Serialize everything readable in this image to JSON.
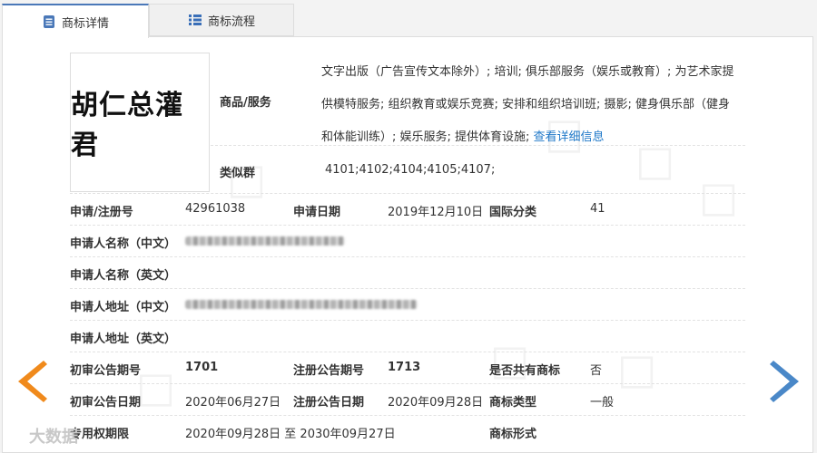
{
  "tabs": [
    {
      "label": "商标详情",
      "active": true
    },
    {
      "label": "商标流程",
      "active": false
    }
  ],
  "trademark": {
    "logo_text": "胡仁总灌君",
    "goods_label": "商品/服务",
    "goods_text": "文字出版（广告宣传文本除外）; 培训; 俱乐部服务（娱乐或教育）; 为艺术家提供模特服务; 组织教育或娱乐竞赛; 安排和组织培训班; 摄影; 健身俱乐部（健身和体能训练）; 娱乐服务; 提供体育设施;",
    "detail_link": "查看详细信息",
    "similar_label": "类似群",
    "similar_value": "4101;4102;4104;4105;4107;"
  },
  "fields": {
    "reg_no_label": "申请/注册号",
    "reg_no_value": "42961038",
    "apply_date_label": "申请日期",
    "apply_date_value": "2019年12月10日",
    "intl_class_label": "国际分类",
    "intl_class_value": "41",
    "applicant_cn_label": "申请人名称（中文）",
    "applicant_en_label": "申请人名称（英文）",
    "address_cn_label": "申请人地址（中文）",
    "address_en_label": "申请人地址（英文）",
    "prelim_no_label": "初审公告期号",
    "prelim_no_value": "1701",
    "reg_pub_no_label": "注册公告期号",
    "reg_pub_no_value": "1713",
    "shared_label": "是否共有商标",
    "shared_value": "否",
    "prelim_date_label": "初审公告日期",
    "prelim_date_value": "2020年06月27日",
    "reg_pub_date_label": "注册公告日期",
    "reg_pub_date_value": "2020年09月28日",
    "type_label": "商标类型",
    "type_value": "一般",
    "exclusive_label": "专用权期限",
    "exclusive_value": "2020年09月28日 至 2030年09月27日",
    "form_label": "商标形式"
  },
  "watermark": {
    "text": "大数据"
  },
  "colors": {
    "accent": "#4a78b8",
    "arrow_left": "#f08a1c",
    "arrow_right": "#4a88c8",
    "link": "#1f78c8"
  }
}
